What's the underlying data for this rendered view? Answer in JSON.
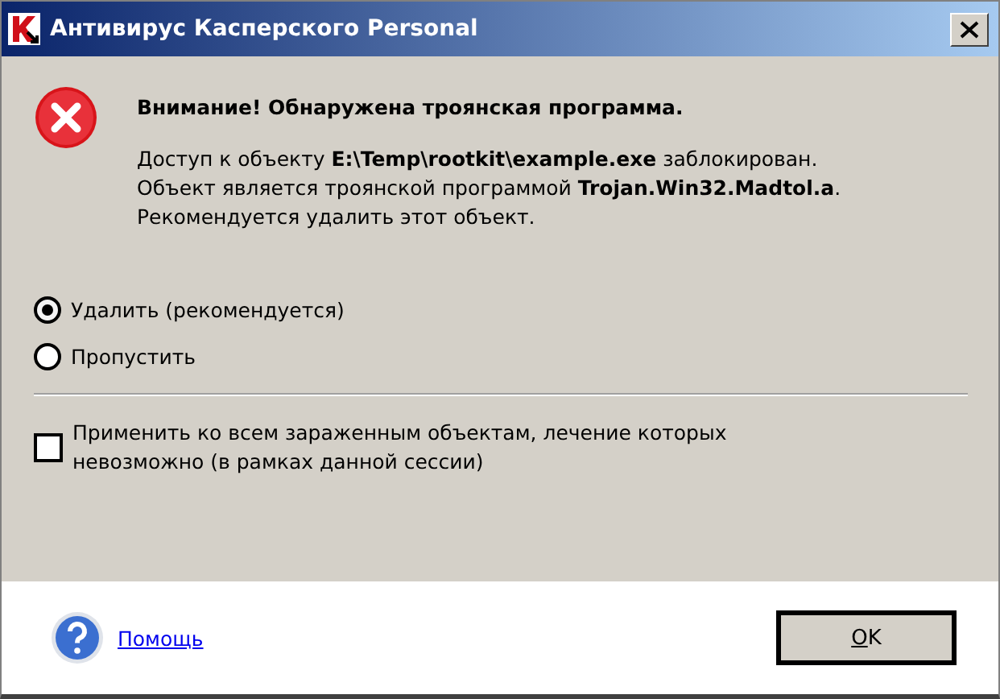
{
  "window": {
    "title": "Антивирус Касперского Personal"
  },
  "message": {
    "heading": "Внимание! Обнаружена троянская программа.",
    "body": "Доступ к объекту **E:\\Temp\\rootkit\\example.exe** заблокирован. Объект является троянской программой **Trojan.Win32.Madtol.a**. Рекомендуется удалить этот объект."
  },
  "actions": [
    {
      "label": "Удалить (рекомендуется)",
      "selected": true
    },
    {
      "label": "Пропустить",
      "selected": false
    }
  ],
  "apply_all": {
    "label": "Применить ко всем зараженным объектам, лечение которых невозможно (в рамках данной сессии)",
    "checked": false
  },
  "footer": {
    "help_link": "Помощь",
    "ok_button": "OK"
  }
}
